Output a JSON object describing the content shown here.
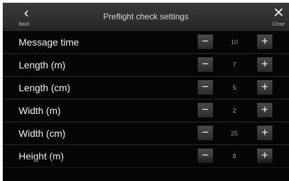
{
  "header": {
    "back_label": "Back",
    "title": "Preflight check settings",
    "close_label": "Close"
  },
  "rows": [
    {
      "label": "Message time",
      "value": "10"
    },
    {
      "label": "Length (m)",
      "value": "7"
    },
    {
      "label": "Length (cm)",
      "value": "5"
    },
    {
      "label": "Width (m)",
      "value": "2"
    },
    {
      "label": "Width (cm)",
      "value": "25"
    },
    {
      "label": "Height (m)",
      "value": "8"
    }
  ],
  "controls": {
    "minus_symbol": "−",
    "plus_symbol": "+"
  },
  "icons": {
    "back": "double-chevron-left-icon",
    "close": "close-icon"
  }
}
